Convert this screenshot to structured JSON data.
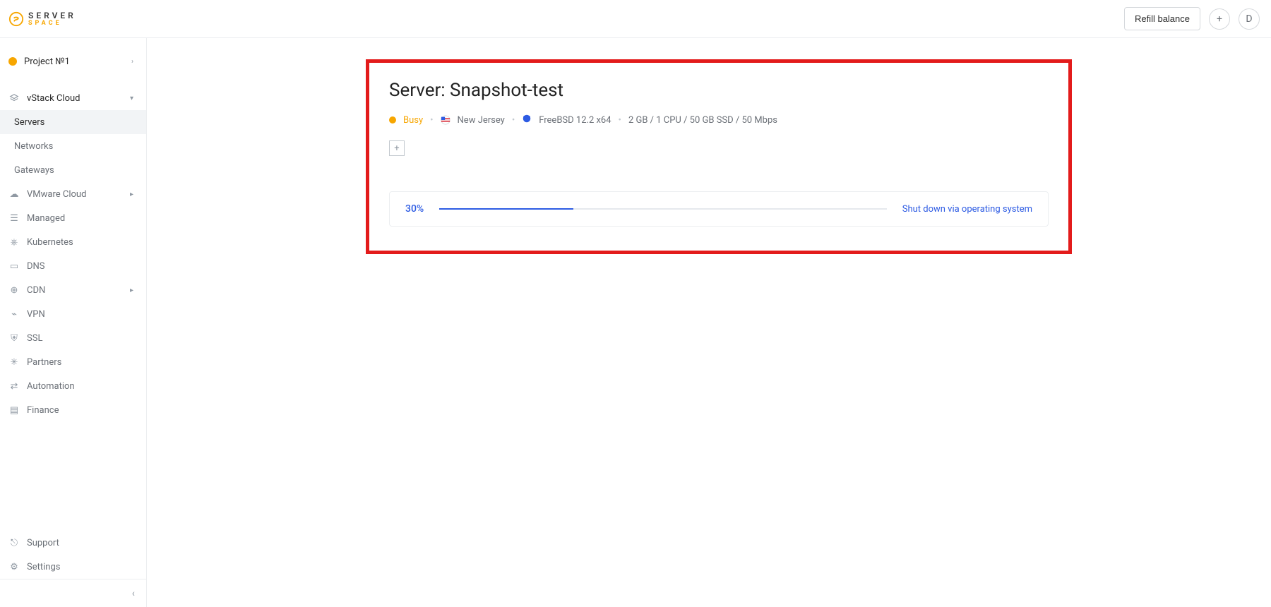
{
  "header": {
    "brand_top": "SERVER",
    "brand_sub": "SPACE",
    "refill_label": "Refill balance",
    "avatar_initial": "D"
  },
  "sidebar": {
    "project_label": "Project №1",
    "groups": [
      {
        "label": "vStack Cloud",
        "open": true,
        "icon": "stack",
        "children": [
          {
            "label": "Servers",
            "active": true
          },
          {
            "label": "Networks",
            "active": false
          },
          {
            "label": "Gateways",
            "active": false
          }
        ]
      },
      {
        "label": "VMware Cloud",
        "open": false,
        "icon": "cloud",
        "children": []
      },
      {
        "label": "Managed",
        "open": false,
        "icon": "managed",
        "children": []
      },
      {
        "label": "Kubernetes",
        "open": false,
        "icon": "kube",
        "children": []
      },
      {
        "label": "DNS",
        "open": false,
        "icon": "dns",
        "children": []
      },
      {
        "label": "CDN",
        "open": false,
        "icon": "cdn",
        "children": []
      },
      {
        "label": "VPN",
        "open": false,
        "icon": "vpn",
        "children": []
      },
      {
        "label": "SSL",
        "open": false,
        "icon": "ssl",
        "children": []
      },
      {
        "label": "Partners",
        "open": false,
        "icon": "partners",
        "children": []
      },
      {
        "label": "Automation",
        "open": false,
        "icon": "automation",
        "children": []
      },
      {
        "label": "Finance",
        "open": false,
        "icon": "finance",
        "children": []
      }
    ],
    "bottom": [
      {
        "label": "Support",
        "icon": "support"
      },
      {
        "label": "Settings",
        "icon": "settings"
      }
    ]
  },
  "server": {
    "title": "Server: Snapshot-test",
    "status": "Busy",
    "location": "New Jersey",
    "os": "FreeBSD 12.2 x64",
    "specs": "2 GB / 1 CPU / 50 GB SSD / 50 Mbps",
    "progress_pct": "30%",
    "progress_value": 30,
    "action_label": "Shut down via operating system"
  }
}
